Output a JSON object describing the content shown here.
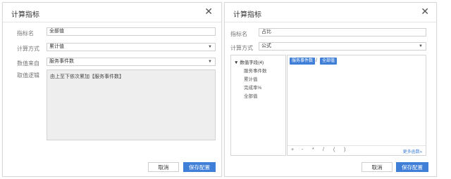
{
  "left": {
    "title": "计算指标",
    "fields": {
      "name_label": "指标名",
      "name_value": "全部值",
      "method_label": "计算方式",
      "method_value": "累计值",
      "source_label": "数值来自",
      "source_value": "服务事件数",
      "logic_label": "取值逻辑",
      "logic_text": "由上至下依次累加【服务事件数】"
    },
    "buttons": {
      "cancel": "取消",
      "save": "保存配置"
    }
  },
  "right": {
    "title": "计算指标",
    "fields": {
      "name_label": "指标名",
      "name_value": "占比",
      "method_label": "计算方式",
      "method_value": "公式"
    },
    "tree": {
      "header": "▼ 数值字段(4)",
      "items": [
        "服务事件数",
        "累计值",
        "完成率%",
        "全部值"
      ]
    },
    "formula": {
      "tag1": "服务事件数",
      "op": "/",
      "tag2": "全部值"
    },
    "operators": [
      "+",
      "-",
      "*",
      "/",
      "(",
      ")"
    ],
    "more_label": "更多函数»",
    "buttons": {
      "cancel": "取消",
      "save": "保存配置"
    }
  },
  "icons": {
    "close": "close-icon",
    "dropdown": "caret-down-icon"
  },
  "colors": {
    "primary": "#3f7fd8",
    "logic_bg": "#eeeeee"
  }
}
